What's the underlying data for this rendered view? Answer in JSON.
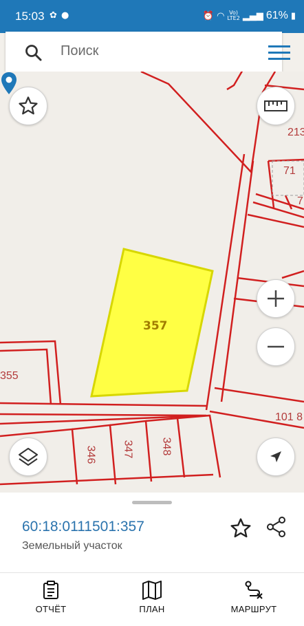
{
  "status": {
    "time": "15:03",
    "lte_top": "Vo)",
    "lte_bottom": "LTE2",
    "battery": "61%"
  },
  "search": {
    "placeholder": "Поиск"
  },
  "map": {
    "parcels": [
      "213",
      "71",
      "7",
      "357",
      "355",
      "101 8",
      "346",
      "347",
      "348"
    ],
    "selected_color": "#ffff44",
    "boundary_color": "#d11f1f"
  },
  "details": {
    "cadastral_number": "60:18:0111501:357",
    "object_type": "Земельный участок"
  },
  "bottom_nav": {
    "report": "ОТЧЁТ",
    "plan": "ПЛАН",
    "route": "МАРШРУТ"
  }
}
